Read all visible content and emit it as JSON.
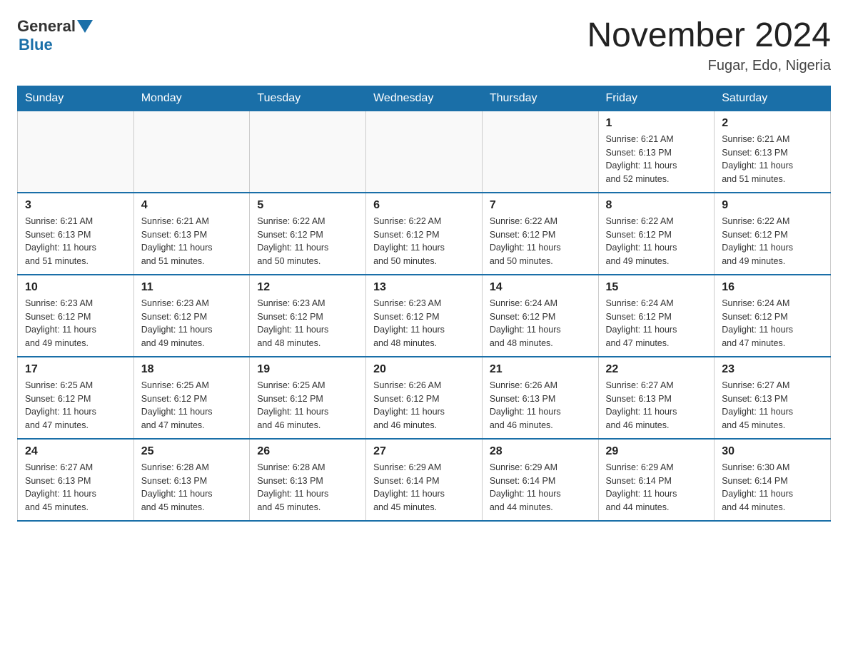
{
  "header": {
    "logo_general": "General",
    "logo_blue": "Blue",
    "month_title": "November 2024",
    "location": "Fugar, Edo, Nigeria"
  },
  "weekdays": [
    "Sunday",
    "Monday",
    "Tuesday",
    "Wednesday",
    "Thursday",
    "Friday",
    "Saturday"
  ],
  "weeks": [
    {
      "days": [
        {
          "number": "",
          "info": ""
        },
        {
          "number": "",
          "info": ""
        },
        {
          "number": "",
          "info": ""
        },
        {
          "number": "",
          "info": ""
        },
        {
          "number": "",
          "info": ""
        },
        {
          "number": "1",
          "info": "Sunrise: 6:21 AM\nSunset: 6:13 PM\nDaylight: 11 hours\nand 52 minutes."
        },
        {
          "number": "2",
          "info": "Sunrise: 6:21 AM\nSunset: 6:13 PM\nDaylight: 11 hours\nand 51 minutes."
        }
      ]
    },
    {
      "days": [
        {
          "number": "3",
          "info": "Sunrise: 6:21 AM\nSunset: 6:13 PM\nDaylight: 11 hours\nand 51 minutes."
        },
        {
          "number": "4",
          "info": "Sunrise: 6:21 AM\nSunset: 6:13 PM\nDaylight: 11 hours\nand 51 minutes."
        },
        {
          "number": "5",
          "info": "Sunrise: 6:22 AM\nSunset: 6:12 PM\nDaylight: 11 hours\nand 50 minutes."
        },
        {
          "number": "6",
          "info": "Sunrise: 6:22 AM\nSunset: 6:12 PM\nDaylight: 11 hours\nand 50 minutes."
        },
        {
          "number": "7",
          "info": "Sunrise: 6:22 AM\nSunset: 6:12 PM\nDaylight: 11 hours\nand 50 minutes."
        },
        {
          "number": "8",
          "info": "Sunrise: 6:22 AM\nSunset: 6:12 PM\nDaylight: 11 hours\nand 49 minutes."
        },
        {
          "number": "9",
          "info": "Sunrise: 6:22 AM\nSunset: 6:12 PM\nDaylight: 11 hours\nand 49 minutes."
        }
      ]
    },
    {
      "days": [
        {
          "number": "10",
          "info": "Sunrise: 6:23 AM\nSunset: 6:12 PM\nDaylight: 11 hours\nand 49 minutes."
        },
        {
          "number": "11",
          "info": "Sunrise: 6:23 AM\nSunset: 6:12 PM\nDaylight: 11 hours\nand 49 minutes."
        },
        {
          "number": "12",
          "info": "Sunrise: 6:23 AM\nSunset: 6:12 PM\nDaylight: 11 hours\nand 48 minutes."
        },
        {
          "number": "13",
          "info": "Sunrise: 6:23 AM\nSunset: 6:12 PM\nDaylight: 11 hours\nand 48 minutes."
        },
        {
          "number": "14",
          "info": "Sunrise: 6:24 AM\nSunset: 6:12 PM\nDaylight: 11 hours\nand 48 minutes."
        },
        {
          "number": "15",
          "info": "Sunrise: 6:24 AM\nSunset: 6:12 PM\nDaylight: 11 hours\nand 47 minutes."
        },
        {
          "number": "16",
          "info": "Sunrise: 6:24 AM\nSunset: 6:12 PM\nDaylight: 11 hours\nand 47 minutes."
        }
      ]
    },
    {
      "days": [
        {
          "number": "17",
          "info": "Sunrise: 6:25 AM\nSunset: 6:12 PM\nDaylight: 11 hours\nand 47 minutes."
        },
        {
          "number": "18",
          "info": "Sunrise: 6:25 AM\nSunset: 6:12 PM\nDaylight: 11 hours\nand 47 minutes."
        },
        {
          "number": "19",
          "info": "Sunrise: 6:25 AM\nSunset: 6:12 PM\nDaylight: 11 hours\nand 46 minutes."
        },
        {
          "number": "20",
          "info": "Sunrise: 6:26 AM\nSunset: 6:12 PM\nDaylight: 11 hours\nand 46 minutes."
        },
        {
          "number": "21",
          "info": "Sunrise: 6:26 AM\nSunset: 6:13 PM\nDaylight: 11 hours\nand 46 minutes."
        },
        {
          "number": "22",
          "info": "Sunrise: 6:27 AM\nSunset: 6:13 PM\nDaylight: 11 hours\nand 46 minutes."
        },
        {
          "number": "23",
          "info": "Sunrise: 6:27 AM\nSunset: 6:13 PM\nDaylight: 11 hours\nand 45 minutes."
        }
      ]
    },
    {
      "days": [
        {
          "number": "24",
          "info": "Sunrise: 6:27 AM\nSunset: 6:13 PM\nDaylight: 11 hours\nand 45 minutes."
        },
        {
          "number": "25",
          "info": "Sunrise: 6:28 AM\nSunset: 6:13 PM\nDaylight: 11 hours\nand 45 minutes."
        },
        {
          "number": "26",
          "info": "Sunrise: 6:28 AM\nSunset: 6:13 PM\nDaylight: 11 hours\nand 45 minutes."
        },
        {
          "number": "27",
          "info": "Sunrise: 6:29 AM\nSunset: 6:14 PM\nDaylight: 11 hours\nand 45 minutes."
        },
        {
          "number": "28",
          "info": "Sunrise: 6:29 AM\nSunset: 6:14 PM\nDaylight: 11 hours\nand 44 minutes."
        },
        {
          "number": "29",
          "info": "Sunrise: 6:29 AM\nSunset: 6:14 PM\nDaylight: 11 hours\nand 44 minutes."
        },
        {
          "number": "30",
          "info": "Sunrise: 6:30 AM\nSunset: 6:14 PM\nDaylight: 11 hours\nand 44 minutes."
        }
      ]
    }
  ]
}
